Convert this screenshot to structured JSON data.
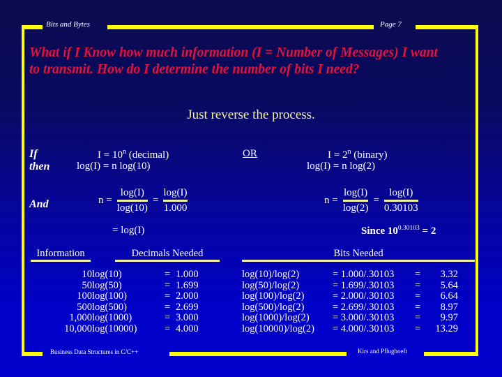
{
  "header": {
    "left_label": "Bits and Bytes",
    "right_label": "Page 7"
  },
  "footer": {
    "left_label": "Business Data Structures in C/C++",
    "right_label": "Kirs and Pflughoeft"
  },
  "title": "What if I Know how much information (I  =  Number of Messages) I want to transmit. How do I determine the number of bits I need?",
  "subtitle": "Just reverse the process.",
  "formulas": {
    "if_label": "If",
    "then_label": "then",
    "and_label": "And",
    "or_label": "OR",
    "decimal": {
      "line1_lhs": "I   =  10",
      "line1_exp": "n",
      "line1_tail": " (decimal)",
      "line2": "log(I)  =   n log(10)"
    },
    "binary": {
      "line1_lhs": "I   =  2",
      "line1_exp": "n",
      "line1_tail": "  (binary)",
      "line2": "log(I)  =  n log(2)"
    },
    "frac_left": {
      "lead": "n  =",
      "num1": "log(I)",
      "den1": "log(10)",
      "op": "=",
      "num2": "log(I)",
      "den2": "1.000"
    },
    "frac_right": {
      "lead": "n   =",
      "num1": "log(I)",
      "den1": "log(2)",
      "op": "=",
      "num2": "log(I)",
      "den2": "0.30103"
    },
    "tail_left": "=  log(I)",
    "tail_right_prefix": "Since 10",
    "tail_right_exp": "0.30103",
    "tail_right_suffix": "  =  2"
  },
  "tables": {
    "headers": {
      "information": "Information",
      "decimals_needed": "Decimals Needed",
      "bits_needed": "Bits Needed"
    },
    "left_rows": [
      {
        "information": "10",
        "expr": "log(10)",
        "eq": "=",
        "value": "1.000"
      },
      {
        "information": "50",
        "expr": "log(50)",
        "eq": "=",
        "value": "1.699"
      },
      {
        "information": "100",
        "expr": "log(100)",
        "eq": "=",
        "value": "2.000"
      },
      {
        "information": "500",
        "expr": "log(500)",
        "eq": "=",
        "value": "2.699"
      },
      {
        "information": "1,000",
        "expr": "log(1000)",
        "eq": "=",
        "value": "3.000"
      },
      {
        "information": "10,000",
        "expr": "log(10000)",
        "eq": "=",
        "value": "4.000"
      }
    ],
    "right_rows": [
      {
        "expr": "log(10)/log(2)",
        "mid": "= 1.000/.30103",
        "eq": "=",
        "value": "3.32"
      },
      {
        "expr": "log(50)/log(2)",
        "mid": "= 1.699/.30103",
        "eq": "=",
        "value": "5.64"
      },
      {
        "expr": "log(100)/log(2)",
        "mid": "= 2.000/.30103",
        "eq": "=",
        "value": "6.64"
      },
      {
        "expr": "log(500)/log(2)",
        "mid": "= 2.699/.30103",
        "eq": "=",
        "value": "8.97"
      },
      {
        "expr": "log(1000)/log(2)",
        "mid": "= 3.000/.30103",
        "eq": "=",
        "value": "9.97"
      },
      {
        "expr": "log(10000)/log(2)",
        "mid": "= 4.000/.30103",
        "eq": "=",
        "value": "13.29"
      }
    ]
  },
  "colors": {
    "background_top": "#0b0b4e",
    "background_bottom": "#0000cc",
    "frame": "#ffff00",
    "title": "#e1133c",
    "subtitle": "#f2f2a0",
    "body_text": "#ffffff",
    "rule": "#f2f2a0"
  }
}
